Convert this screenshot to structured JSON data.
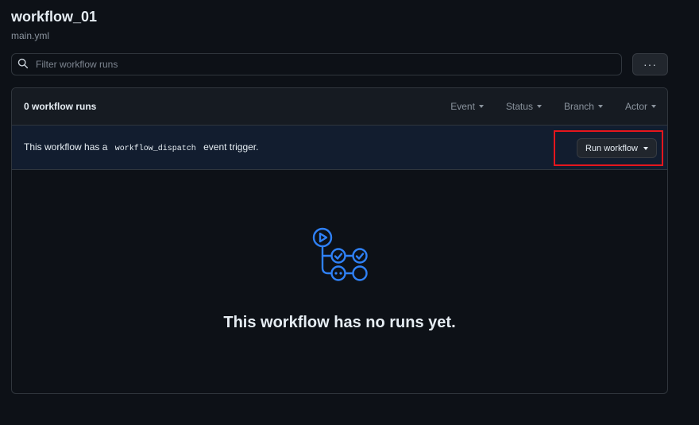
{
  "page": {
    "title": "workflow_01",
    "subtitle": "main.yml"
  },
  "search": {
    "placeholder": "Filter workflow runs",
    "icon": "search-icon"
  },
  "toolbar": {
    "more_label": "···"
  },
  "runs": {
    "count_label": "0 workflow runs",
    "filters": [
      "Event",
      "Status",
      "Branch",
      "Actor"
    ]
  },
  "banner": {
    "text_before": "This workflow has a",
    "code": "workflow_dispatch",
    "text_after": "event trigger.",
    "run_button_label": "Run workflow"
  },
  "empty_state": {
    "icon": "workflow-icon",
    "message": "This workflow has no runs yet."
  },
  "colors": {
    "background": "#0d1117",
    "accent_blue": "#2f81f7",
    "highlight_red": "#e5161d"
  }
}
